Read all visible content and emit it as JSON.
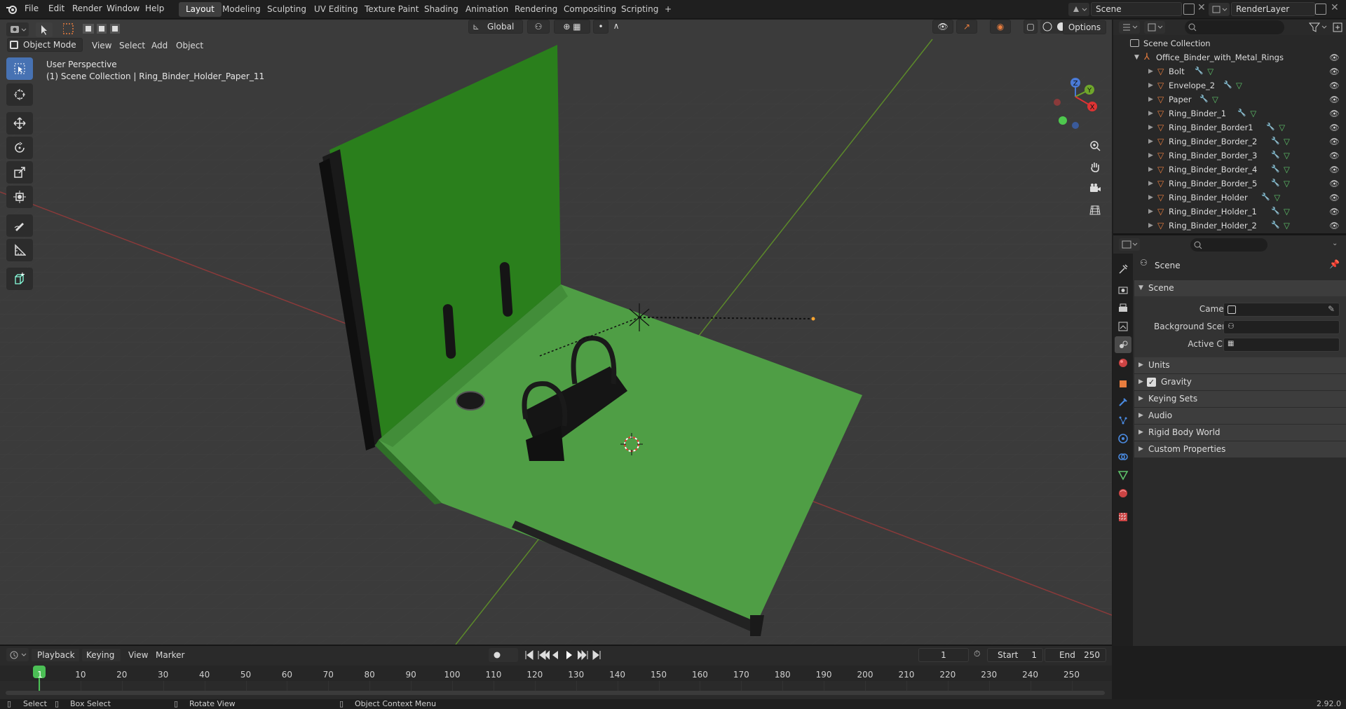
{
  "topbar": {
    "menus": [
      "File",
      "Edit",
      "Render",
      "Window",
      "Help"
    ],
    "workspaces": [
      "Layout",
      "Modeling",
      "Sculpting",
      "UV Editing",
      "Texture Paint",
      "Shading",
      "Animation",
      "Rendering",
      "Compositing",
      "Scripting"
    ],
    "add_tab": "+",
    "scene": "Scene",
    "render_layer": "RenderLayer"
  },
  "viewport": {
    "mode": "Object Mode",
    "menus": [
      "View",
      "Select",
      "Add",
      "Object"
    ],
    "transform_orientation": "Global",
    "options": "Options",
    "view_name": "User Perspective",
    "context": "(1) Scene Collection | Ring_Binder_Holder_Paper_11",
    "gizmo_axes": {
      "x": "X",
      "y": "Y",
      "z": "Z"
    },
    "colors": {
      "background": "#3b3b3b",
      "binder": "#3d8f2c",
      "x_axis": "#8a3a3a",
      "y_axis": "#5c8a2a",
      "active_tool": "#4772b3"
    }
  },
  "outliner": {
    "root": "Scene Collection",
    "collection": "Office_Binder_with_Metal_Rings",
    "items": [
      "Bolt",
      "Envelope_2",
      "Paper",
      "Ring_Binder_1",
      "Ring_Binder_Border1",
      "Ring_Binder_Border_2",
      "Ring_Binder_Border_3",
      "Ring_Binder_Border_4",
      "Ring_Binder_Border_5",
      "Ring_Binder_Holder",
      "Ring_Binder_Holder_1",
      "Ring_Binder_Holder_2"
    ]
  },
  "properties": {
    "context": "Scene",
    "section": "Scene",
    "fields": {
      "camera": "Camera",
      "background_scene": "Background Scene",
      "active_clip": "Active Clip"
    },
    "subsections": [
      "Units",
      "Gravity",
      "Keying Sets",
      "Audio",
      "Rigid Body World",
      "Custom Properties"
    ],
    "gravity_checked": true
  },
  "timeline": {
    "menus": [
      "Playback",
      "Keying",
      "View",
      "Marker"
    ],
    "current_frame": "1",
    "start_label": "Start",
    "start": "1",
    "end_label": "End",
    "end": "250",
    "ticks": [
      "1",
      "10",
      "20",
      "30",
      "40",
      "50",
      "60",
      "70",
      "80",
      "90",
      "100",
      "110",
      "120",
      "130",
      "140",
      "150",
      "160",
      "170",
      "180",
      "190",
      "200",
      "210",
      "220",
      "230",
      "240",
      "250"
    ]
  },
  "status": {
    "select": "Select",
    "box_select": "Box Select",
    "rotate": "Rotate View",
    "context_menu": "Object Context Menu",
    "version": "2.92.0"
  }
}
